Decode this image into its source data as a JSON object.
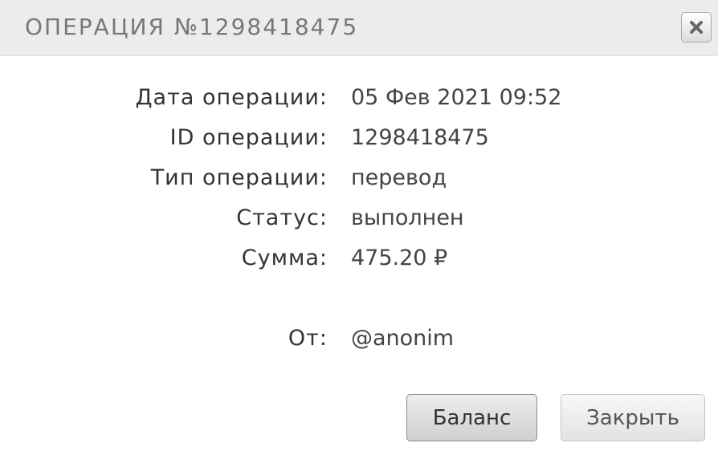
{
  "dialog": {
    "title": "ОПЕРАЦИЯ №1298418475",
    "close_icon": "close-x-icon"
  },
  "details": {
    "date_label": "Дата операции:",
    "date_value": "05 Фев 2021 09:52",
    "id_label": "ID операции:",
    "id_value": "1298418475",
    "type_label": "Тип операции:",
    "type_value": "перевод",
    "status_label": "Статус:",
    "status_value": "выполнен",
    "amount_label": "Сумма:",
    "amount_value": "475.20 ₽",
    "from_label": "От:",
    "from_value": "@anonim"
  },
  "buttons": {
    "balance_label": "Баланс",
    "close_label": "Закрыть"
  }
}
